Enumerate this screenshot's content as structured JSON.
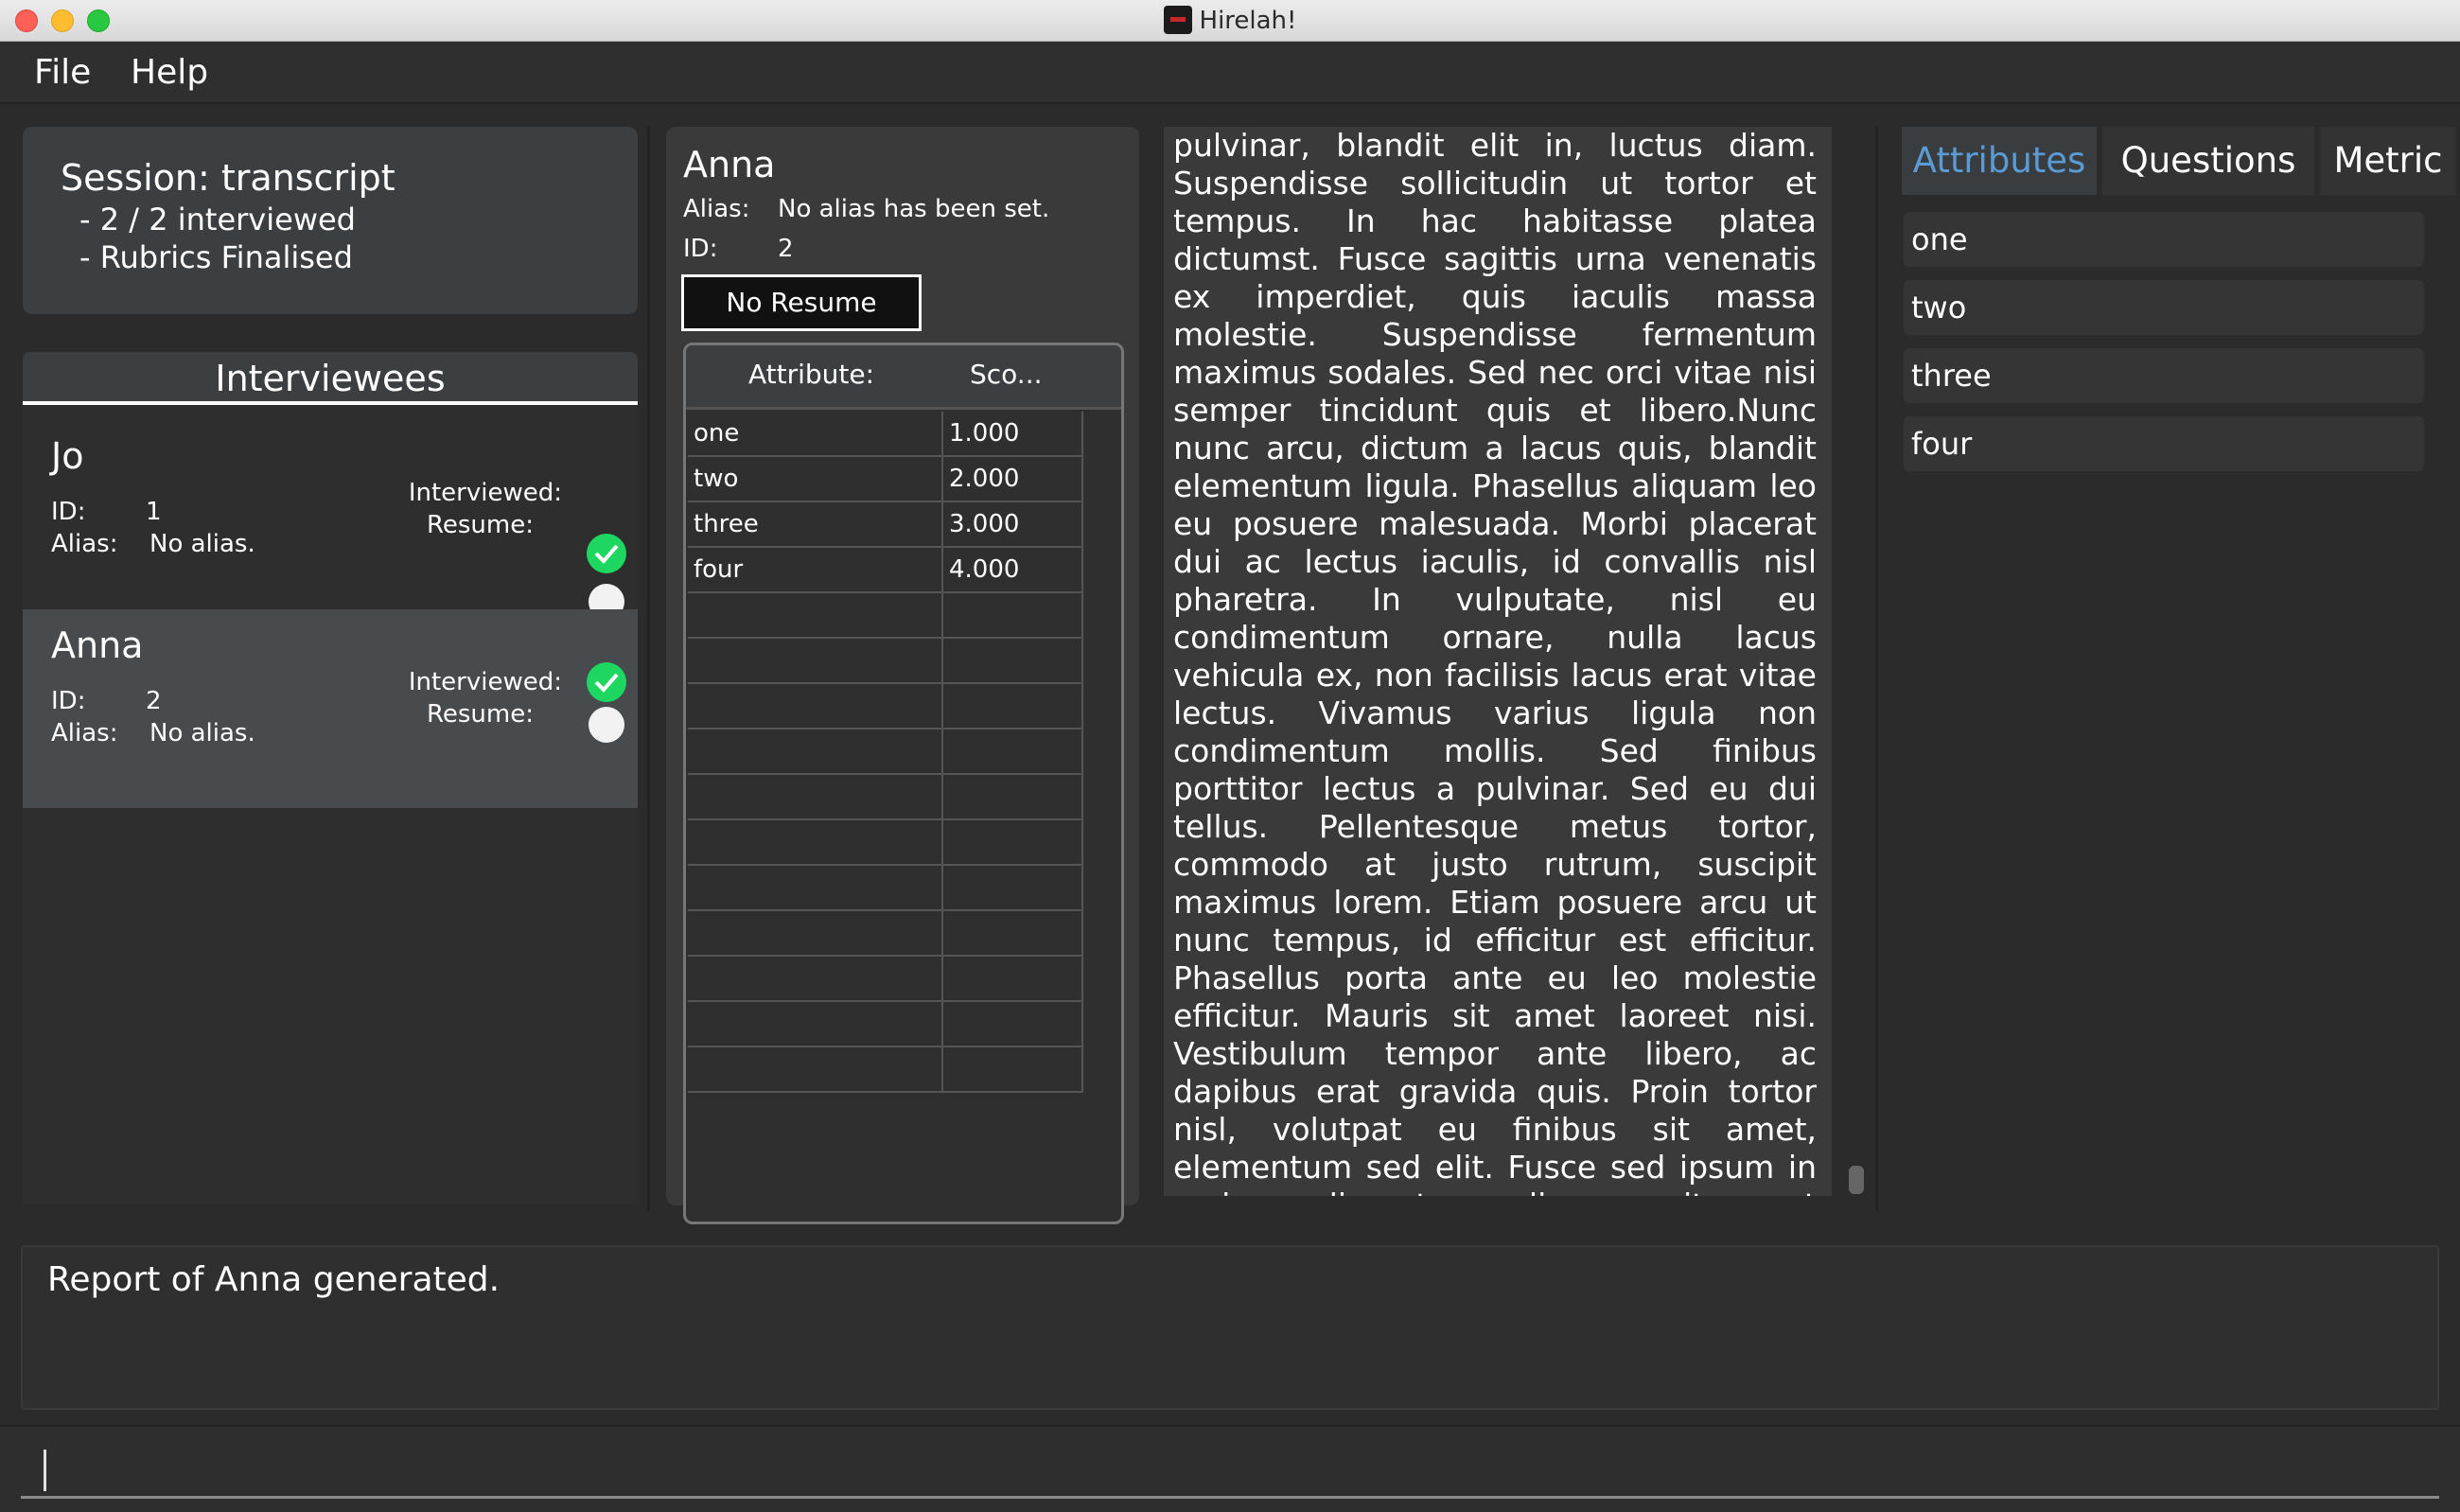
{
  "window": {
    "title": "Hirelah!"
  },
  "menu": {
    "file": "File",
    "help": "Help"
  },
  "session": {
    "title": "Session: transcript",
    "lines": [
      "- 2 / 2 interviewed",
      "- Rubrics Finalised"
    ]
  },
  "interviewees": {
    "header": "Interviewees",
    "items": [
      {
        "name": "Jo",
        "id_label": "ID:",
        "id": "1",
        "alias_label": "Alias:",
        "alias": "No alias.",
        "interviewed_label": "Interviewed:",
        "resume_label": "Resume:"
      },
      {
        "name": "Anna",
        "id_label": "ID:",
        "id": "2",
        "alias_label": "Alias:",
        "alias": "No alias.",
        "interviewed_label": "Interviewed:",
        "resume_label": "Resume:"
      }
    ]
  },
  "detail": {
    "name": "Anna",
    "alias_label": "Alias:",
    "alias": "No alias has been set.",
    "id_label": "ID:",
    "id": "2",
    "resume_button": "No Resume",
    "table": {
      "headers": [
        "Attribute:",
        "Sco..."
      ],
      "rows": [
        {
          "attribute": "one",
          "score": "1.000"
        },
        {
          "attribute": "two",
          "score": "2.000"
        },
        {
          "attribute": "three",
          "score": "3.000"
        },
        {
          "attribute": "four",
          "score": "4.000"
        }
      ]
    }
  },
  "transcript": {
    "text": "pulvinar, blandit elit in, luctus diam. Suspendisse sollicitudin ut tortor et tempus. In hac habitasse platea dictumst. Fusce sagittis urna venenatis ex imperdiet, quis iaculis massa molestie. Suspendisse fermentum maximus sodales. Sed nec orci vitae nisi semper tincidunt quis et libero.Nunc nunc arcu, dictum a lacus quis, blandit elementum ligula. Phasellus aliquam leo eu posuere malesuada. Morbi placerat dui ac lectus iaculis, id convallis nisl pharetra. In vulputate, nisl eu condimentum ornare, nulla lacus vehicula ex, non facilisis lacus erat vitae lectus. Vivamus varius ligula non condimentum mollis. Sed finibus porttitor lectus a pulvinar. Sed eu dui tellus. Pellentesque metus tortor, commodo at justo rutrum, suscipit maximus lorem. Etiam posuere arcu ut nunc tempus, id efficitur est efficitur. Phasellus porta ante eu leo molestie efficitur. Mauris sit amet laoreet nisi. Vestibulum tempor ante libero, ac dapibus erat gravida quis. Proin tortor nisl, volutpat eu finibus sit amet, elementum sed elit. Fusce sed ipsum in orci condimentum aliquam sit amet venenatis mi. Fusce dignissim massa quis vestibulum tincidunt. Phasellus mattis odio sed dui aliquet finibus."
  },
  "tabs": {
    "items": [
      "Attributes",
      "Questions",
      "Metric"
    ],
    "active": "Attributes",
    "attributes": [
      "one",
      "two",
      "three",
      "four"
    ]
  },
  "result": {
    "text": "Report of Anna generated."
  },
  "command": {
    "value": ""
  },
  "colors": {
    "accent": "#5b9bd5",
    "check": "#1ed760",
    "background": "#2b2b2b",
    "card": "#3c3f41"
  },
  "icons": {
    "interviewed": "check-circle-icon",
    "resume": "circle-icon"
  }
}
